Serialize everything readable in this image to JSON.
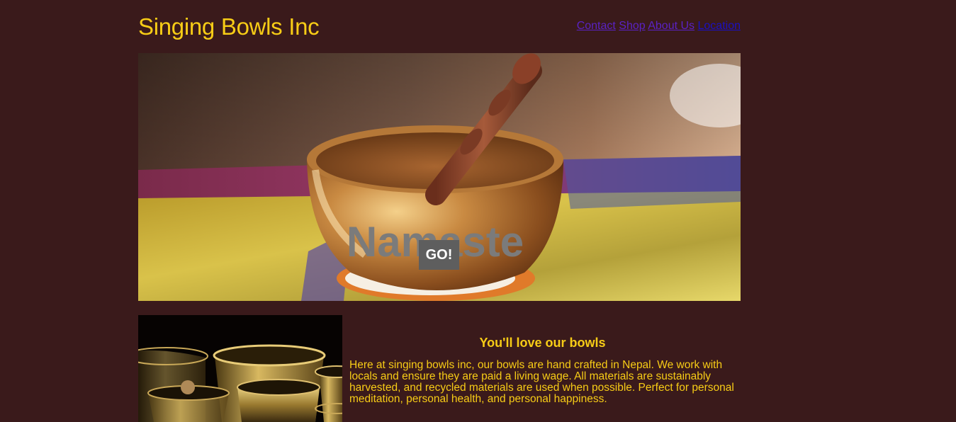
{
  "header": {
    "title": "Singing Bowls Inc",
    "nav": [
      "Contact",
      "Shop",
      "About Us",
      "Location"
    ]
  },
  "hero": {
    "heading": "Namaste",
    "button_label": "GO!"
  },
  "about": {
    "heading": "You'll love our bowls",
    "body": "Here at singing bowls inc, our bowls are hand crafted in Nepal. We work with locals and ensure they are paid a living wage. All materials are sustainably harvested, and recycled materials are used when possible. Perfect for personal meditation, personal health, and personal happiness."
  },
  "colors": {
    "background": "#3a1a1b",
    "accent": "#f7cc16",
    "link": "#5a22c4",
    "button": "#5e5e5e"
  }
}
